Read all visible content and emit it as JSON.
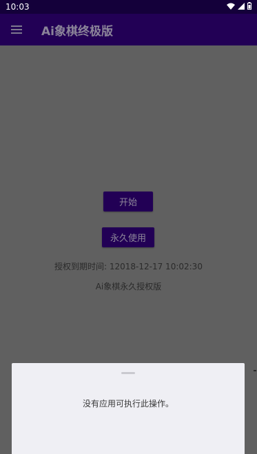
{
  "status_bar": {
    "time": "10:03",
    "icons": [
      "wifi-icon",
      "signal-icon",
      "battery-icon"
    ]
  },
  "app_bar": {
    "title": "Ai象棋终极版",
    "menu_icon": "hamburger-menu-icon"
  },
  "main": {
    "start_button_label": "开始",
    "permanent_use_button_label": "永久使用",
    "expiry_text": "授权到期时间: 12018-12-17 10:02:30",
    "version_text": "Ai象棋永久授权版"
  },
  "bottom_sheet": {
    "message": "没有应用可执行此操作。"
  },
  "colors": {
    "status_bar_bg": "#14003a",
    "app_bar_bg": "#220055",
    "scrim_bg": "#606060",
    "sheet_bg": "#efeff4"
  }
}
